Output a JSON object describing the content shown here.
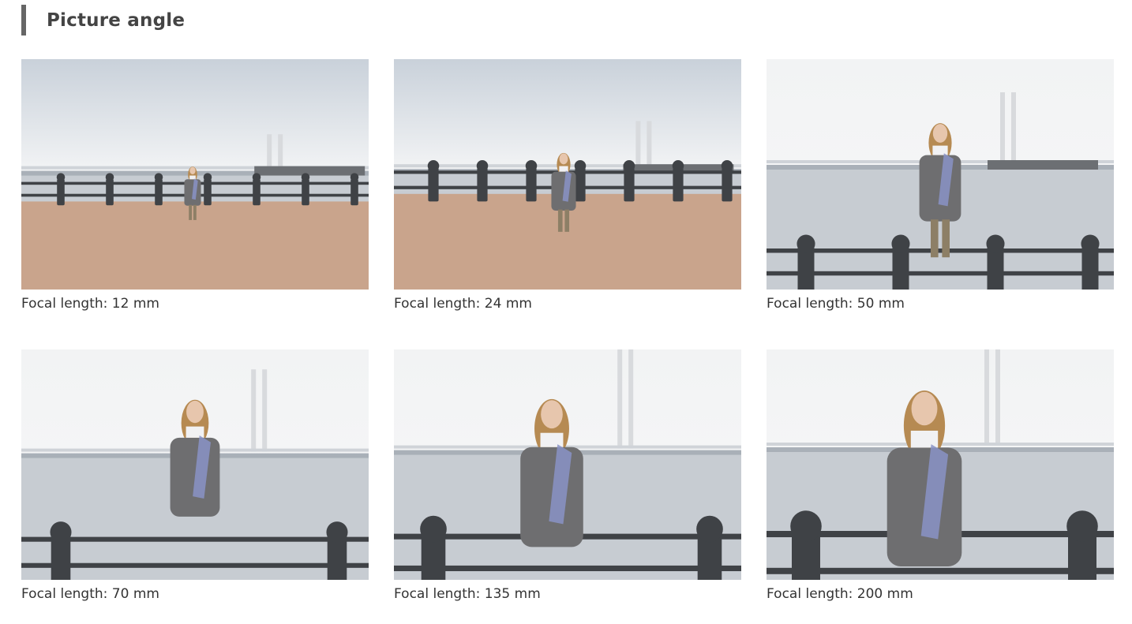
{
  "section": {
    "title": "Picture angle"
  },
  "photos": [
    {
      "caption": "Focal length: 12 mm",
      "zoom": 0.12
    },
    {
      "caption": "Focal length: 24 mm",
      "zoom": 0.24
    },
    {
      "caption": "Focal length: 50 mm",
      "zoom": 0.5
    },
    {
      "caption": "Focal length: 70 mm",
      "zoom": 0.62
    },
    {
      "caption": "Focal length: 135 mm",
      "zoom": 0.82
    },
    {
      "caption": "Focal length: 200 mm",
      "zoom": 1.0
    }
  ],
  "colors": {
    "heading_bar": "#666666",
    "heading_text": "#444444",
    "caption_text": "#333333",
    "sky": "#e9ecef",
    "sea": "#c7ccd2",
    "pavement": "#c9a48c",
    "railing": "#3f4246",
    "hair": "#b68a52",
    "top": "#6e6e70",
    "scarf": "#8a93c6"
  }
}
